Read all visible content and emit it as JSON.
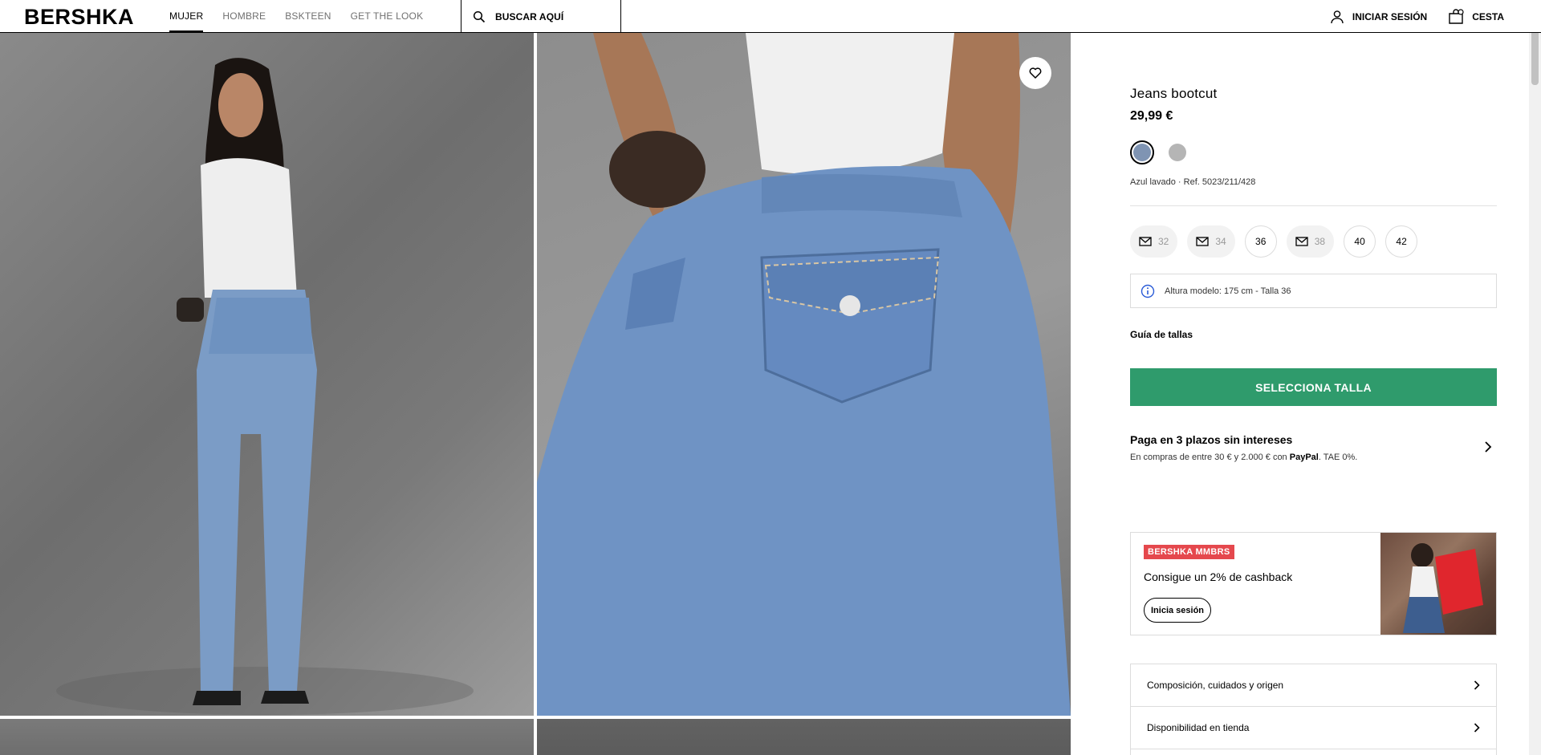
{
  "header": {
    "logo": "BERSHKA",
    "nav": [
      "MUJER",
      "HOMBRE",
      "BSKTEEN",
      "GET THE LOOK"
    ],
    "search_label": "BUSCAR AQUÍ",
    "login_label": "INICIAR SESIÓN",
    "cart_label": "CESTA"
  },
  "product": {
    "title": "Jeans bootcut",
    "price": "29,99 €",
    "colors": [
      {
        "name": "Azul lavado",
        "hex": "#7f94b3",
        "selected": true
      },
      {
        "name": "Gris",
        "hex": "#b5b5b5",
        "selected": false
      }
    ],
    "ref_text": "Azul lavado · Ref. 5023/211/428",
    "sizes": [
      {
        "label": "32",
        "available": false
      },
      {
        "label": "34",
        "available": false
      },
      {
        "label": "36",
        "available": true
      },
      {
        "label": "38",
        "available": false
      },
      {
        "label": "40",
        "available": true
      },
      {
        "label": "42",
        "available": true
      }
    ],
    "model_info": "Altura modelo: 175 cm - Talla 36",
    "size_guide": "Guía de tallas",
    "cta": "SELECCIONA TALLA"
  },
  "payment": {
    "title": "Paga en 3 plazos sin intereses",
    "sub_prefix": "En compras de entre 30 € y 2.000 € con ",
    "sub_brand": "PayPal",
    "sub_suffix": ". TAE 0%."
  },
  "promo": {
    "badge": "BERSHKA MMBRS",
    "text": "Consigue un 2% de cashback",
    "button": "Inicia sesión"
  },
  "accordion": [
    "Composición, cuidados y origen",
    "Disponibilidad en tienda"
  ],
  "colors": {
    "accent": "#2f9b6c",
    "badge": "#e5484d"
  }
}
